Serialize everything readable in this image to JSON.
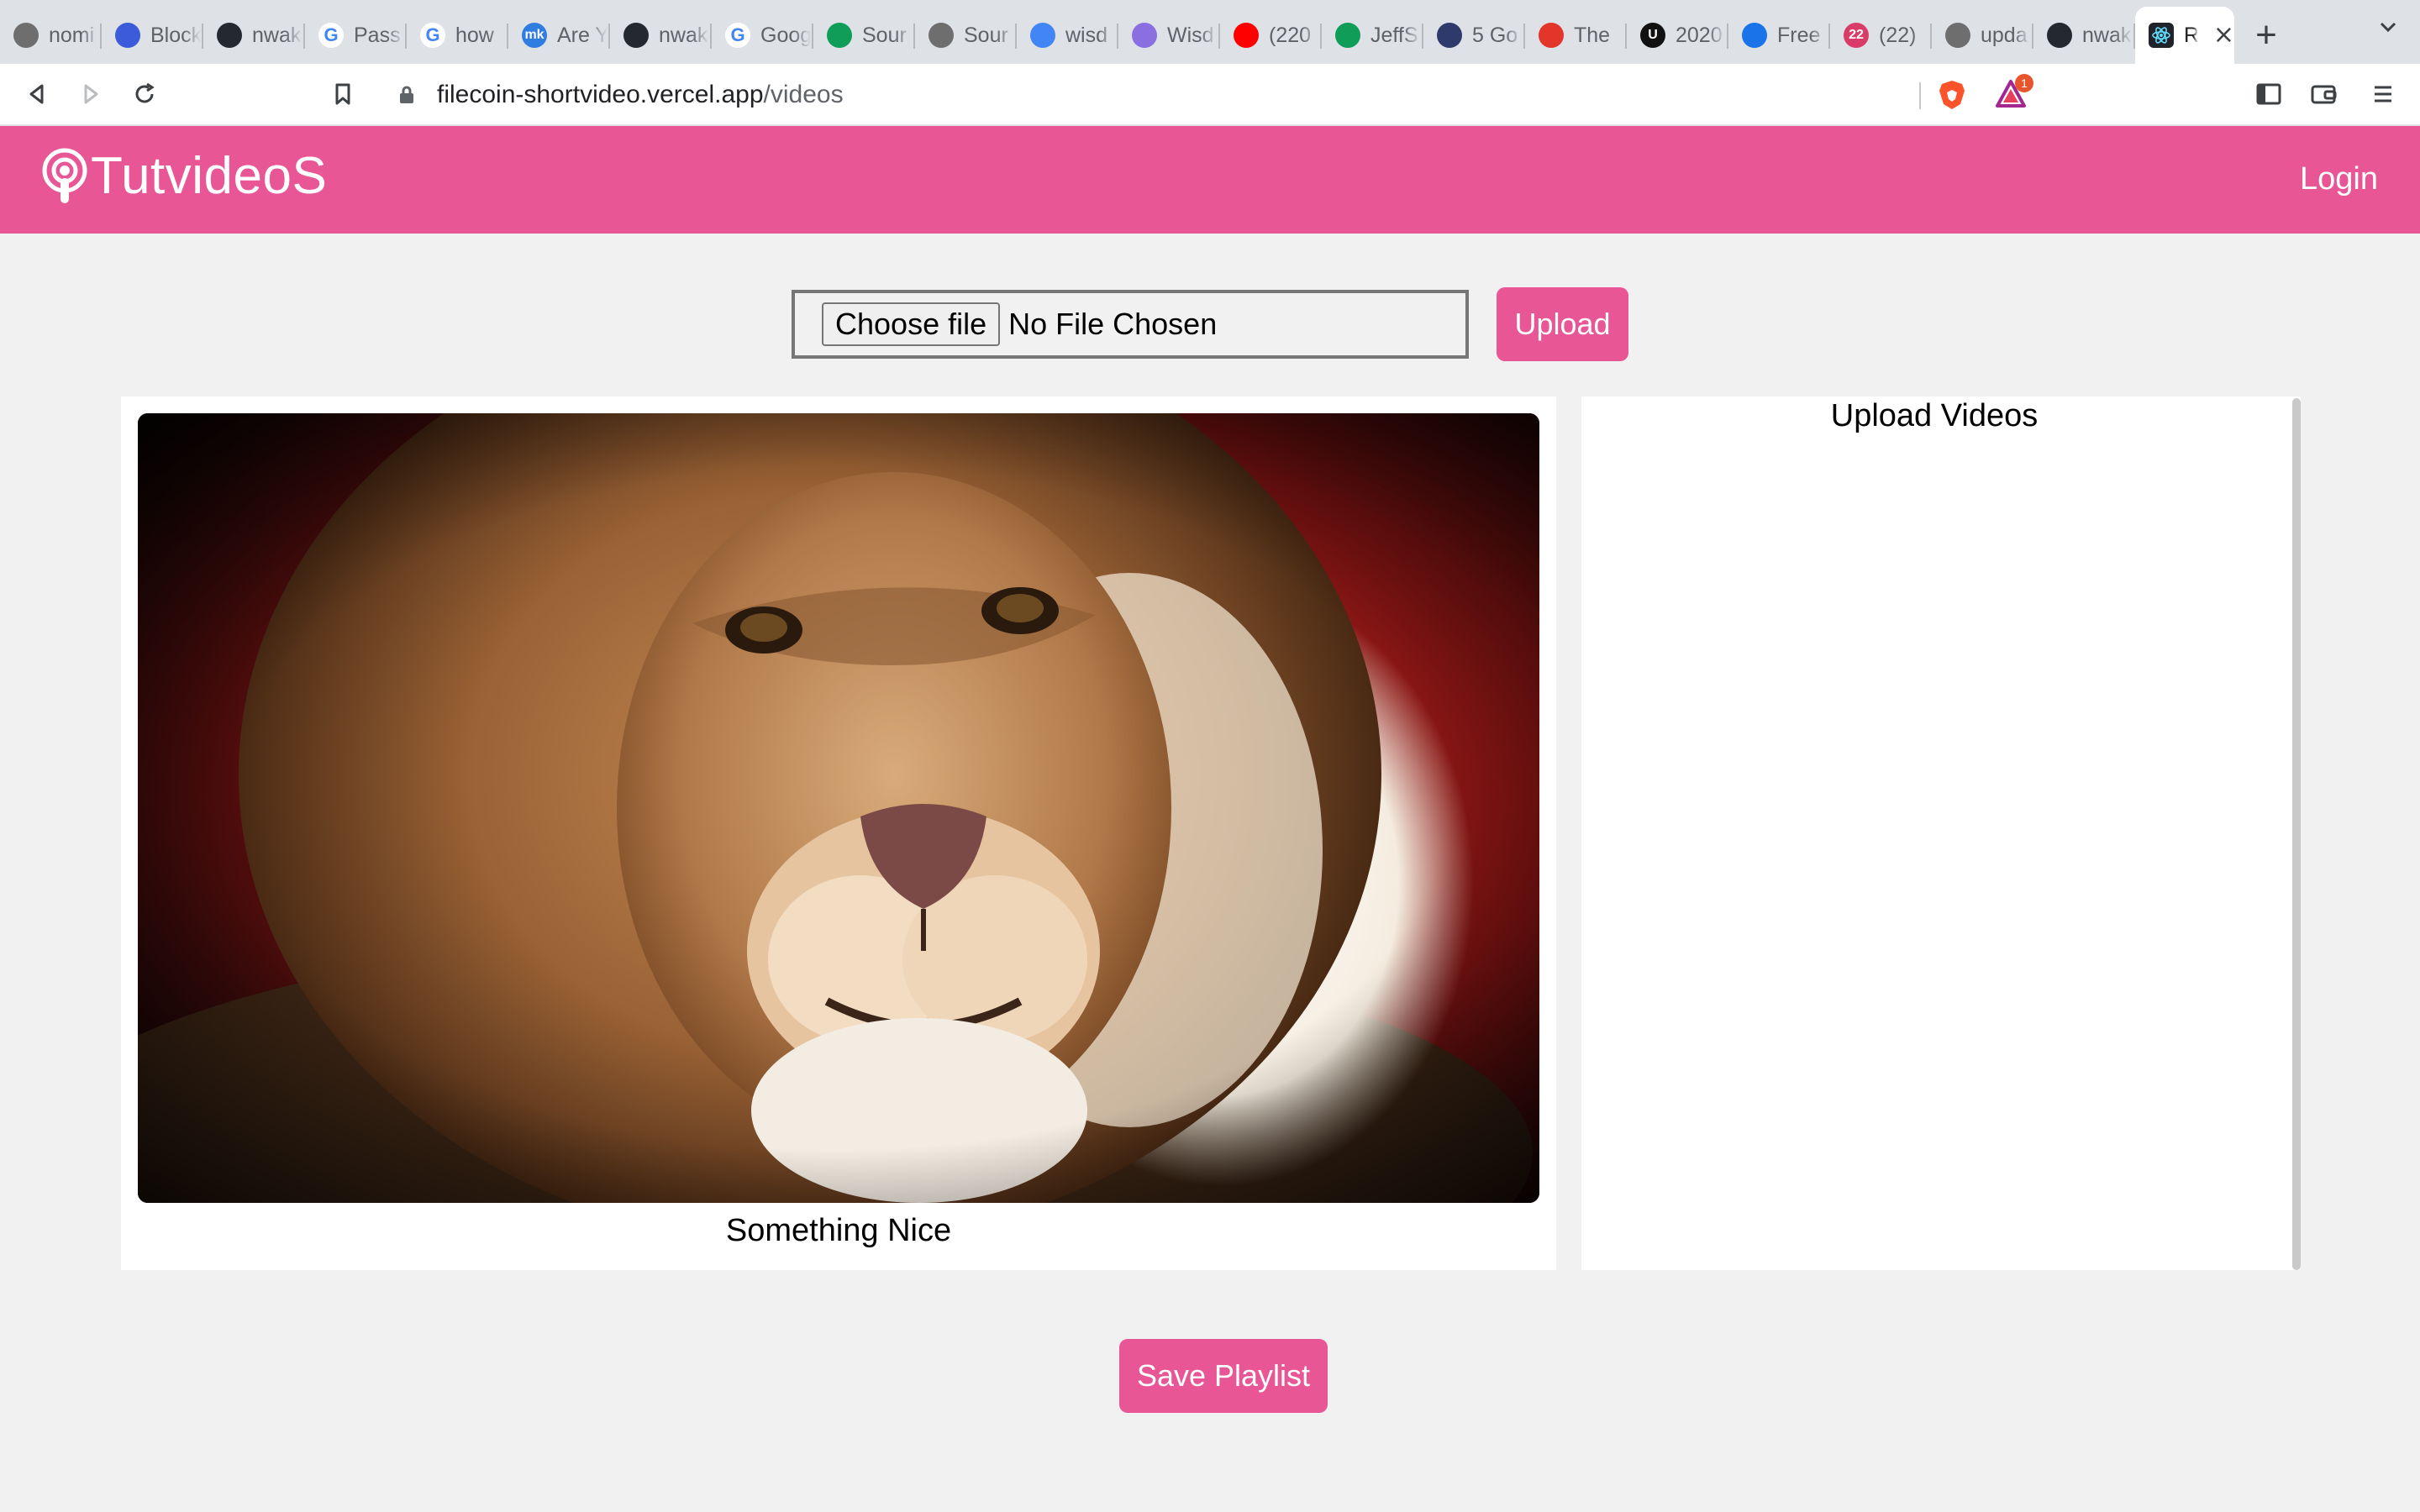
{
  "browser": {
    "tabs": [
      {
        "label": "nomi",
        "icon": "globe-icon",
        "color": "#6e6e6e"
      },
      {
        "label": "Block",
        "icon": "hexagon-logo-icon",
        "color": "#3b5bdb"
      },
      {
        "label": "nwak",
        "icon": "github-icon",
        "color": "#24292f"
      },
      {
        "label": "Pass",
        "icon": "google-icon",
        "color": "#4285f4"
      },
      {
        "label": "how",
        "icon": "google-icon",
        "color": "#4285f4"
      },
      {
        "label": "Are Y",
        "icon": "mk-logo-icon",
        "color": "#2f7de1"
      },
      {
        "label": "nwak",
        "icon": "github-icon",
        "color": "#24292f"
      },
      {
        "label": "Goog",
        "icon": "google-icon",
        "color": "#4285f4"
      },
      {
        "label": "Sour",
        "icon": "google-drive-icon",
        "color": "#0f9d58"
      },
      {
        "label": "Sour",
        "icon": "globe-icon",
        "color": "#6e6e6e"
      },
      {
        "label": "wisd",
        "icon": "google-docs-icon",
        "color": "#4285f4"
      },
      {
        "label": "Wisd",
        "icon": "wisdom-logo-icon",
        "color": "#8a6fe0"
      },
      {
        "label": "(220",
        "icon": "youtube-icon",
        "color": "#ff0000"
      },
      {
        "label": "JeffS",
        "icon": "google-drive-icon",
        "color": "#0f9d58"
      },
      {
        "label": "5 Go",
        "icon": "shield-logo-icon",
        "color": "#2d3a6b"
      },
      {
        "label": "The",
        "icon": "nbc-peacock-icon",
        "color": "#e4352b"
      },
      {
        "label": "2020",
        "icon": "u-logo-icon",
        "color": "#111111"
      },
      {
        "label": "Free",
        "icon": "filter-logo-icon",
        "color": "#1a73e8"
      },
      {
        "label": "(22)",
        "icon": "calendar-22-icon",
        "color": "#d93d67"
      },
      {
        "label": "upda",
        "icon": "globe-icon",
        "color": "#6e6e6e"
      },
      {
        "label": "nwak",
        "icon": "github-icon",
        "color": "#24292f"
      }
    ],
    "active_tab": {
      "label": "R",
      "icon": "react-icon",
      "color": "#61dafb"
    },
    "url_host": "filecoin-shortvideo.vercel.app",
    "url_path": "/videos",
    "extension_badge": "1"
  },
  "app": {
    "brand": "TutvideoS",
    "login": "Login",
    "brand_color": "#e85696",
    "file_input": {
      "button_label": "Choose file",
      "status": "No File Chosen"
    },
    "upload_button": "Upload",
    "video": {
      "title": "Something Nice"
    },
    "upload_panel_title": "Upload Videos",
    "save_button": "Save Playlist"
  }
}
